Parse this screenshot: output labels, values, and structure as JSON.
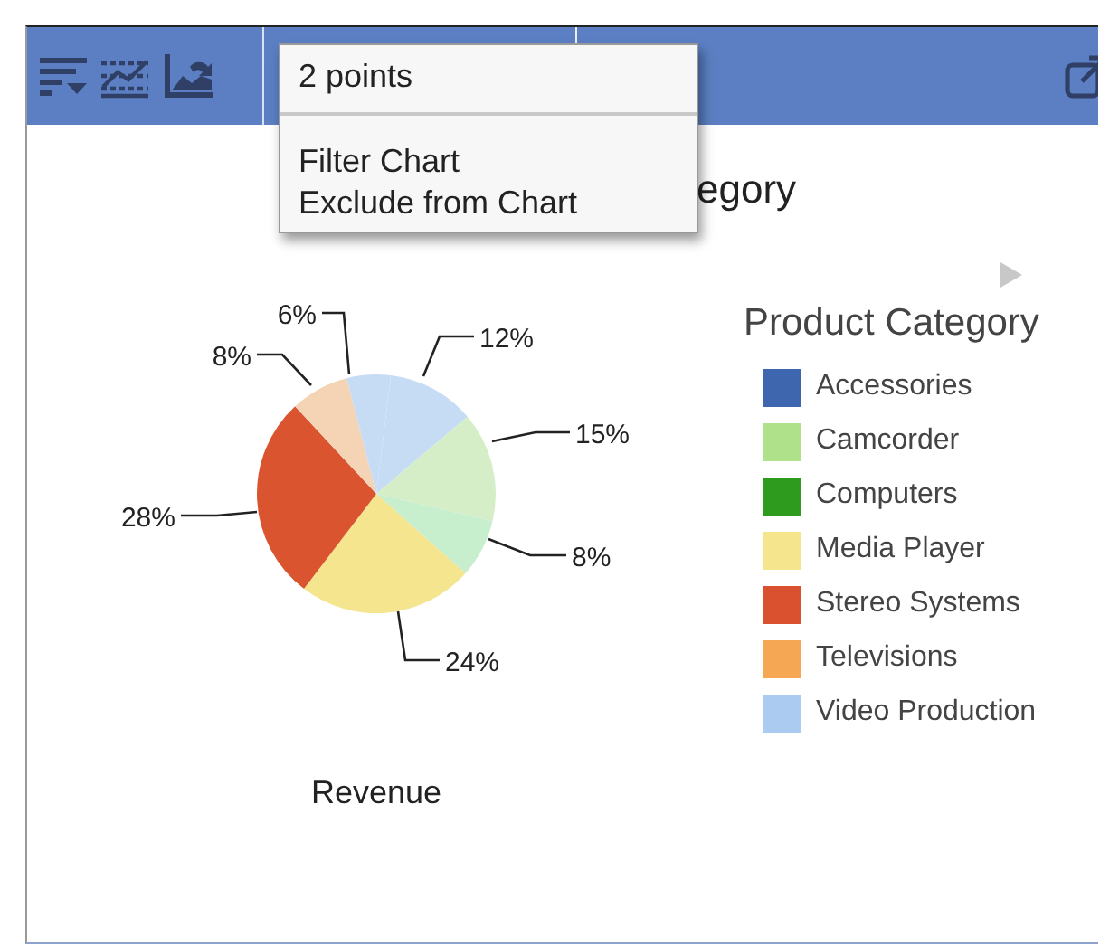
{
  "toolbar": {
    "context_menu": {
      "header": "2 points",
      "items": [
        {
          "label": "Filter Chart"
        },
        {
          "label": "Exclude from Chart"
        }
      ]
    }
  },
  "chart": {
    "title": "egory",
    "caption": "Revenue",
    "chart_data": {
      "type": "pie",
      "values": [
        12,
        15,
        8,
        24,
        28,
        8,
        6
      ],
      "colors": [
        "#c6dcf5",
        "#d5eec8",
        "#c7efce",
        "#f5e58f",
        "#d9542f",
        "#f5d3b5",
        "#c6dcf5"
      ],
      "value_labels": [
        "12%",
        "15%",
        "8%",
        "24%",
        "28%",
        "8%",
        "6%"
      ]
    }
  },
  "legend": {
    "title": "Product Category",
    "items": [
      {
        "label": "Accessories",
        "color": "#3d66ae"
      },
      {
        "label": "Camcorder",
        "color": "#afe08a"
      },
      {
        "label": "Computers",
        "color": "#2e9a1e"
      },
      {
        "label": "Media Player",
        "color": "#f5e68e"
      },
      {
        "label": "Stereo Systems",
        "color": "#d9512f"
      },
      {
        "label": "Televisions",
        "color": "#f5a753"
      },
      {
        "label": "Video Production",
        "color": "#abcbf0"
      }
    ]
  }
}
